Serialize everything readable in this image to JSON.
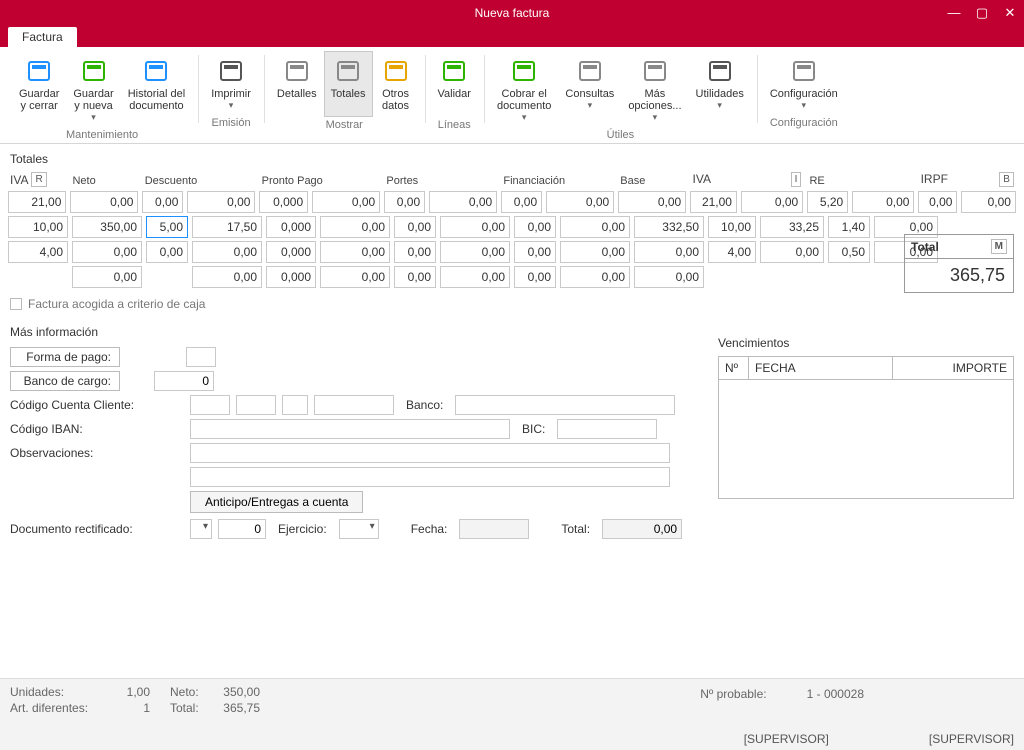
{
  "window": {
    "title": "Nueva factura"
  },
  "tabs": {
    "main": "Factura"
  },
  "ribbon": {
    "groups": [
      {
        "label": "Mantenimiento",
        "buttons": [
          {
            "line1": "Guardar",
            "line2": "y cerrar",
            "name": "guardar-cerrar"
          },
          {
            "line1": "Guardar",
            "line2": "y nueva",
            "name": "guardar-nueva",
            "dropdown": true
          },
          {
            "line1": "Historial del",
            "line2": "documento",
            "name": "historial"
          }
        ]
      },
      {
        "label": "Emisión",
        "buttons": [
          {
            "line1": "Imprimir",
            "line2": "",
            "name": "imprimir",
            "dropdown": true
          }
        ]
      },
      {
        "label": "Mostrar",
        "buttons": [
          {
            "line1": "Detalles",
            "line2": "",
            "name": "detalles"
          },
          {
            "line1": "Totales",
            "line2": "",
            "name": "totales",
            "active": true
          },
          {
            "line1": "Otros",
            "line2": "datos",
            "name": "otros-datos"
          }
        ]
      },
      {
        "label": "Líneas",
        "buttons": [
          {
            "line1": "Validar",
            "line2": "",
            "name": "validar"
          }
        ]
      },
      {
        "label": "Útiles",
        "buttons": [
          {
            "line1": "Cobrar el",
            "line2": "documento",
            "name": "cobrar",
            "dropdown": true
          },
          {
            "line1": "Consultas",
            "line2": "",
            "name": "consultas",
            "dropdown": true
          },
          {
            "line1": "Más",
            "line2": "opciones...",
            "name": "mas-opciones",
            "dropdown": true
          },
          {
            "line1": "Utilidades",
            "line2": "",
            "name": "utilidades",
            "dropdown": true
          }
        ]
      },
      {
        "label": "Configuración",
        "buttons": [
          {
            "line1": "Configuración",
            "line2": "",
            "name": "configuracion",
            "dropdown": true
          }
        ]
      }
    ]
  },
  "sections": {
    "totales": "Totales",
    "masinfo": "Más información",
    "venc": "Vencimientos"
  },
  "totals_headers": {
    "iva": "IVA",
    "r_badge": "R",
    "neto": "Neto",
    "descuento": "Descuento",
    "pronto_pago": "Pronto Pago",
    "portes": "Portes",
    "financiacion": "Financiación",
    "base": "Base",
    "iva2": "IVA",
    "i_badge": "I",
    "re": "RE",
    "irpf": "IRPF",
    "b_badge": "B"
  },
  "totals_rows": [
    {
      "iva_r": "21,00",
      "neto": "0,00",
      "desc_p": "0,00",
      "desc_v": "0,00",
      "pp_p": "0,000",
      "pp_v": "0,00",
      "portes_p": "0,00",
      "portes_v": "0,00",
      "fin_p": "0,00",
      "fin_v": "0,00",
      "base": "0,00",
      "iva2_r": "21,00",
      "iva2_v": "0,00",
      "re_r": "5,20",
      "re_v": "0,00",
      "irpf_r": "0,00",
      "irpf_v": "0,00"
    },
    {
      "iva_r": "10,00",
      "neto": "350,00",
      "desc_p": "5,00",
      "desc_v": "17,50",
      "pp_p": "0,000",
      "pp_v": "0,00",
      "portes_p": "0,00",
      "portes_v": "0,00",
      "fin_p": "0,00",
      "fin_v": "0,00",
      "base": "332,50",
      "iva2_r": "10,00",
      "iva2_v": "33,25",
      "re_r": "1,40",
      "re_v": "0,00"
    },
    {
      "iva_r": "4,00",
      "neto": "0,00",
      "desc_p": "0,00",
      "desc_v": "0,00",
      "pp_p": "0,000",
      "pp_v": "0,00",
      "portes_p": "0,00",
      "portes_v": "0,00",
      "fin_p": "0,00",
      "fin_v": "0,00",
      "base": "0,00",
      "iva2_r": "4,00",
      "iva2_v": "0,00",
      "re_r": "0,50",
      "re_v": "0,00"
    },
    {
      "neto": "0,00",
      "desc_v": "0,00",
      "pp_p": "0,000",
      "pp_v": "0,00",
      "portes_p": "0,00",
      "portes_v": "0,00",
      "fin_p": "0,00",
      "fin_v": "0,00",
      "base": "0,00"
    }
  ],
  "grand_total": {
    "label": "Total",
    "m_badge": "M",
    "value": "365,75"
  },
  "checkbox": {
    "label": "Factura acogida a criterio de caja"
  },
  "masinfo": {
    "forma_pago": "Forma de pago:",
    "banco_cargo": "Banco de cargo:",
    "banco_cargo_val": "0",
    "cc_cliente": "Código Cuenta Cliente:",
    "banco": "Banco:",
    "iban": "Código IBAN:",
    "bic": "BIC:",
    "observaciones": "Observaciones:",
    "anticipo_btn": "Anticipo/Entregas a cuenta",
    "doc_rect": "Documento rectificado:",
    "doc_rect_val": "0",
    "ejercicio": "Ejercicio:",
    "fecha": "Fecha:",
    "total": "Total:",
    "total_val": "0,00"
  },
  "venc_headers": {
    "n": "Nº",
    "fecha": "FECHA",
    "importe": "IMPORTE"
  },
  "footer": {
    "unidades_l": "Unidades:",
    "unidades_v": "1,00",
    "neto_l": "Neto:",
    "neto_v": "350,00",
    "art_l": "Art. diferentes:",
    "art_v": "1",
    "total_l": "Total:",
    "total_v": "365,75",
    "probable_l": "Nº probable:",
    "probable_v": "1 - 000028",
    "supervisor": "[SUPERVISOR]"
  },
  "icons": {
    "guardar-cerrar": "#1e90ff",
    "guardar-nueva": "#2db400",
    "historial": "#1e90ff",
    "imprimir": "#555",
    "detalles": "#888",
    "totales": "#888",
    "otros-datos": "#e6a500",
    "validar": "#2db400",
    "cobrar": "#2db400",
    "consultas": "#888",
    "mas-opciones": "#888",
    "utilidades": "#555",
    "configuracion": "#888"
  }
}
